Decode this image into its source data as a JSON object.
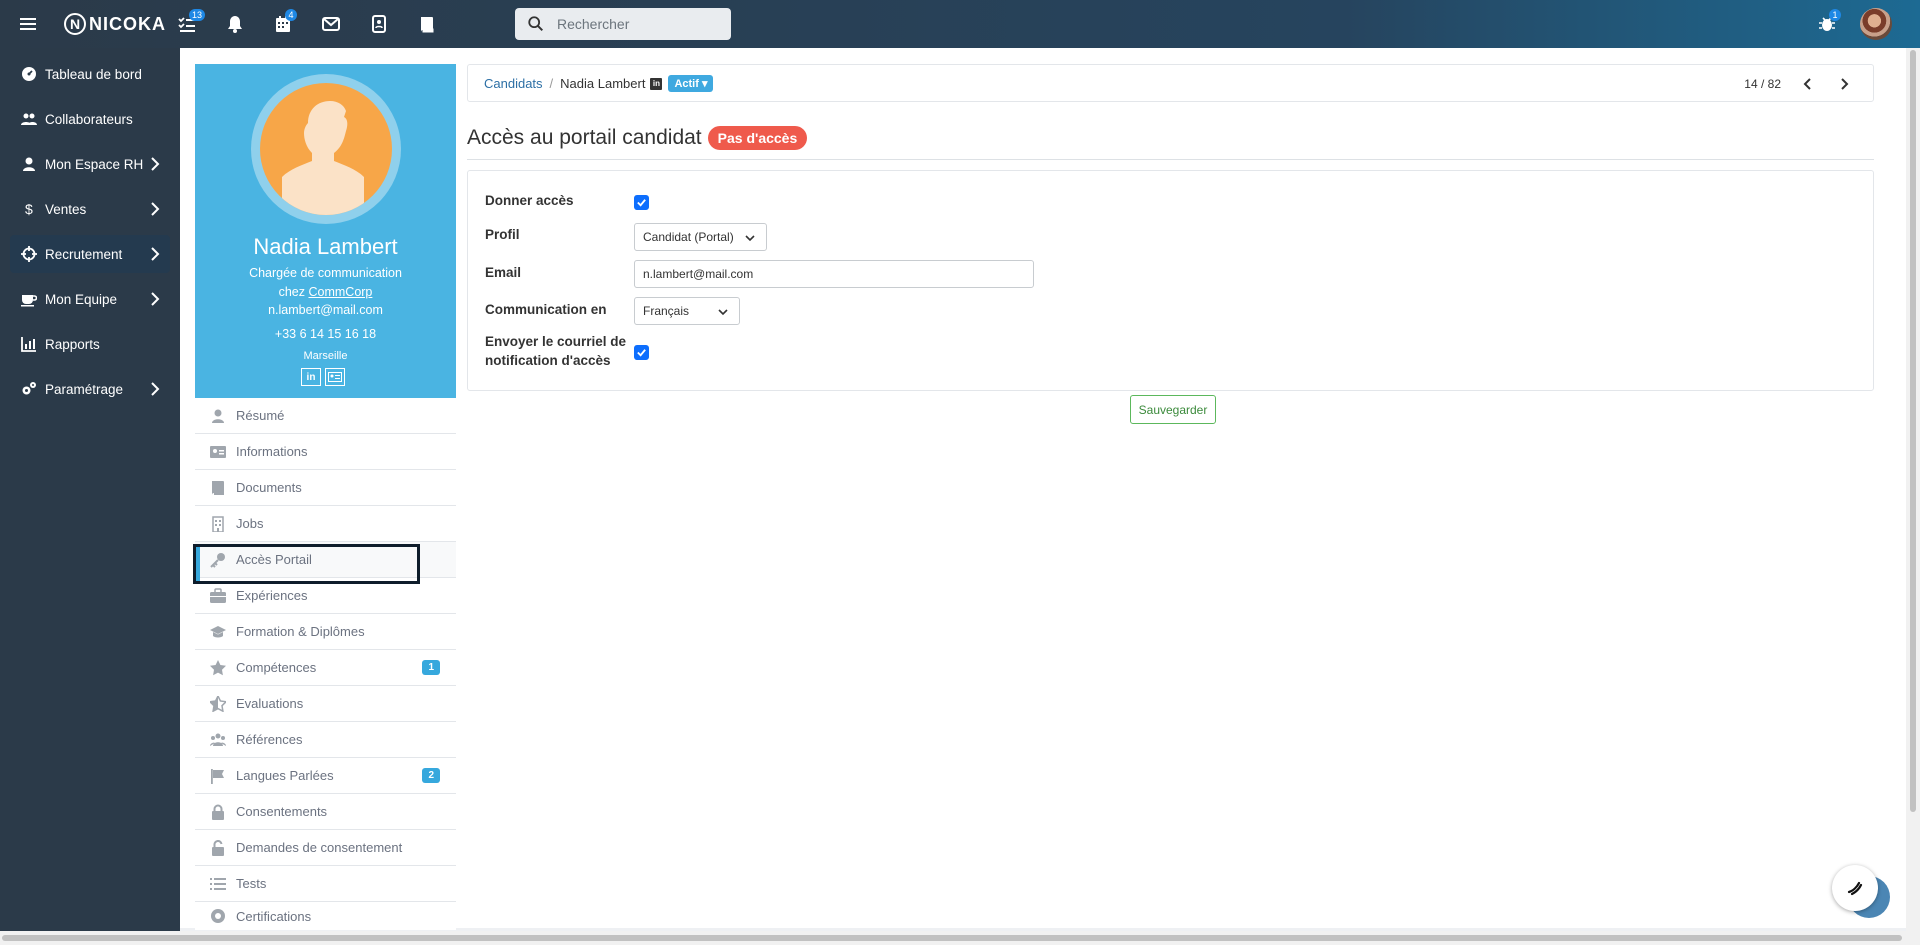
{
  "topbar": {
    "logo_text": "NICOKA",
    "tasks_badge": "13",
    "calendar_badge": "4",
    "search_placeholder": "Rechercher",
    "bug_badge": "1"
  },
  "nav": {
    "items": [
      {
        "label": "Tableau de bord",
        "icon": "dashboard-icon"
      },
      {
        "label": "Collaborateurs",
        "icon": "users-icon"
      },
      {
        "label": "Mon Espace RH",
        "icon": "user-icon"
      },
      {
        "label": "Ventes",
        "icon": "dollar-icon"
      },
      {
        "label": "Recrutement",
        "icon": "crosshairs-icon"
      },
      {
        "label": "Mon Equipe",
        "icon": "coffee-icon"
      },
      {
        "label": "Rapports",
        "icon": "chart-icon"
      },
      {
        "label": "Paramétrage",
        "icon": "cogs-icon"
      }
    ]
  },
  "profile": {
    "name": "Nadia Lambert",
    "title": "Chargée de communication",
    "company_prefix": "chez",
    "company": "CommCorp",
    "email": "n.lambert@mail.com",
    "phone": "+33 6 14 15 16 18",
    "city": "Marseille",
    "linkedin_label": "in"
  },
  "profile_menu": [
    {
      "label": "Résumé",
      "icon": "user-icon"
    },
    {
      "label": "Informations",
      "icon": "id-card-icon"
    },
    {
      "label": "Documents",
      "icon": "book-icon"
    },
    {
      "label": "Jobs",
      "icon": "building-icon"
    },
    {
      "label": "Accès Portail",
      "icon": "key-icon"
    },
    {
      "label": "Expériences",
      "icon": "briefcase-icon"
    },
    {
      "label": "Formation & Diplômes",
      "icon": "graduation-cap-icon"
    },
    {
      "label": "Compétences",
      "icon": "star-icon",
      "badge": "1"
    },
    {
      "label": "Evaluations",
      "icon": "star-half-icon"
    },
    {
      "label": "Références",
      "icon": "people-icon"
    },
    {
      "label": "Langues Parlées",
      "icon": "flag-icon",
      "badge": "2"
    },
    {
      "label": "Consentements",
      "icon": "lock-icon"
    },
    {
      "label": "Demandes de consentement",
      "icon": "unlock-icon"
    },
    {
      "label": "Tests",
      "icon": "list-icon"
    },
    {
      "label": "Certifications",
      "icon": "certificate-icon"
    }
  ],
  "breadcrumb": {
    "root": "Candidats",
    "separator": "/",
    "current": "Nadia Lambert",
    "linkedin_label": "in",
    "status": "Actif",
    "pager": "14 / 82"
  },
  "section": {
    "title": "Accès au portail candidat",
    "badge": "Pas d'accès"
  },
  "form": {
    "give_access_label": "Donner accès",
    "give_access_checked": true,
    "profile_label": "Profil",
    "profile_value": "Candidat (Portal)",
    "email_label": "Email",
    "email_value": "n.lambert@mail.com",
    "language_label": "Communication en",
    "language_value": "Français",
    "notify_label_line1": "Envoyer le courriel de",
    "notify_label_line2": "notification d'accès",
    "notify_checked": true,
    "save_label": "Sauvegarder"
  }
}
